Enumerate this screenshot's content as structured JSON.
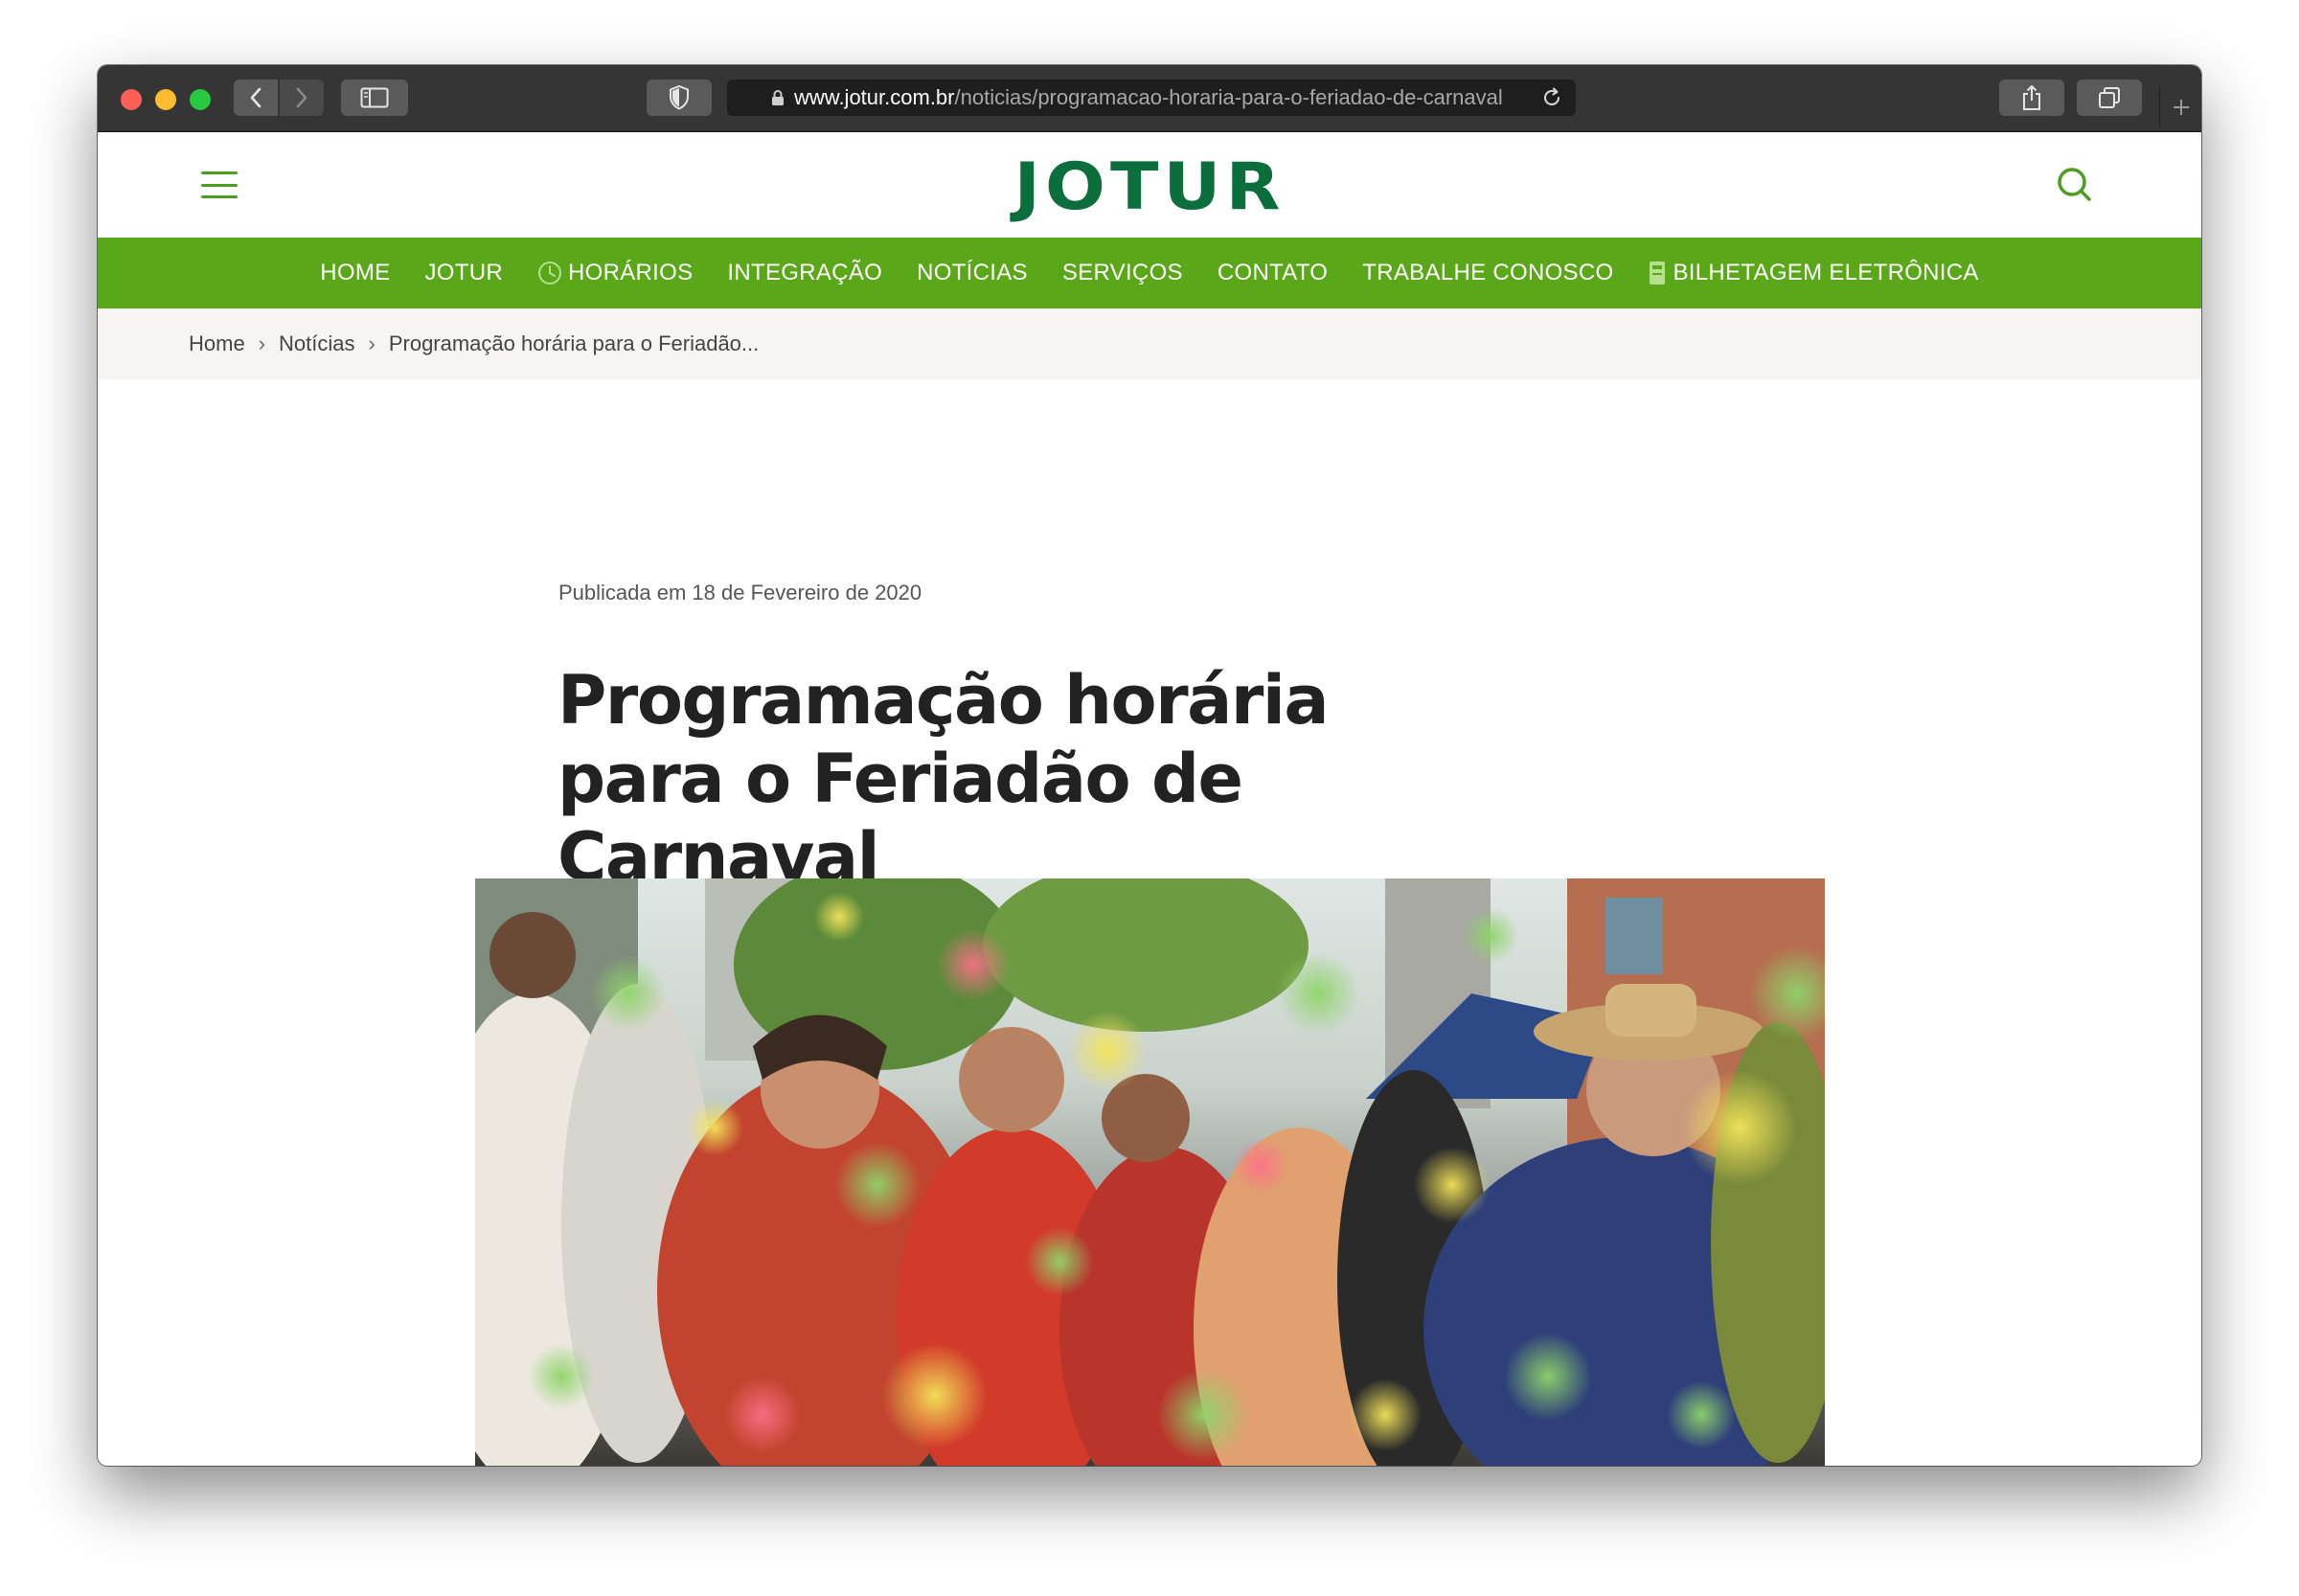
{
  "browser": {
    "url_host": "www.jotur.com.br",
    "url_path": "/noticias/programacao-horaria-para-o-feriadao-de-carnaval"
  },
  "site": {
    "logo": "JOTUR",
    "brand_green": "#5aa719",
    "logo_green": "#0b6e3c"
  },
  "nav": {
    "items": [
      {
        "label": "HOME"
      },
      {
        "label": "JOTUR"
      },
      {
        "label": "HORÁRIOS",
        "icon": "clock-icon"
      },
      {
        "label": "INTEGRAÇÃO"
      },
      {
        "label": "NOTÍCIAS"
      },
      {
        "label": "SERVIÇOS"
      },
      {
        "label": "CONTATO"
      },
      {
        "label": "TRABALHE CONOSCO"
      },
      {
        "label": "BILHETAGEM ELETRÔNICA",
        "icon": "card-icon"
      }
    ]
  },
  "breadcrumb": {
    "home": "Home",
    "section": "Notícias",
    "current": "Programação horária para o Feriadão..."
  },
  "article": {
    "published": "Publicada em 18 de Fevereiro de 2020",
    "title": "Programação horária para o Feriadão de Carnaval",
    "image": "carnival-street-party-photo"
  }
}
